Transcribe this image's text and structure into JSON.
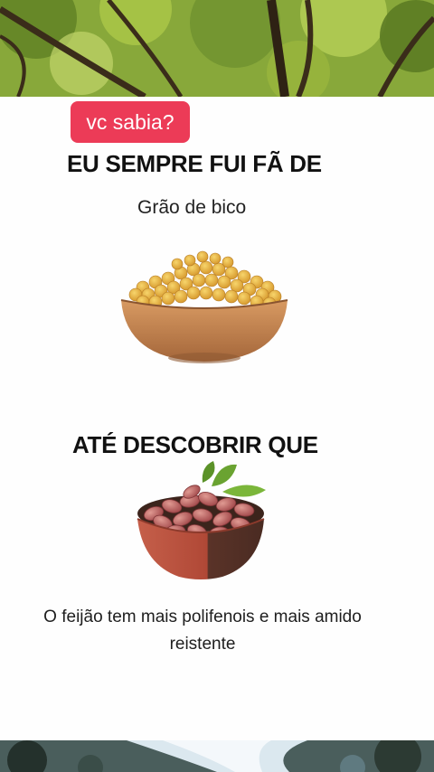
{
  "badge": {
    "label": "vc sabia?"
  },
  "headings": {
    "first": "EU SEMPRE FUI FÃ DE",
    "second": "ATÉ DESCOBRIR QUE"
  },
  "subtitle": "Grão de bico",
  "footer": {
    "line1": "O feijão tem mais polifenois e mais amido",
    "line2": "reistente"
  },
  "colors": {
    "badge": "#ec3b57",
    "heading": "#111111",
    "bowl_wood": "#c98a55",
    "chickpea": "#e9b23a",
    "bean": "#b5585a",
    "leaf": "#6aa331"
  },
  "icons": {
    "top_image": "forest-canopy-photo",
    "bottom_image": "waterfall-photo",
    "food_1": "chickpea-bowl",
    "food_2": "bean-bowl"
  }
}
